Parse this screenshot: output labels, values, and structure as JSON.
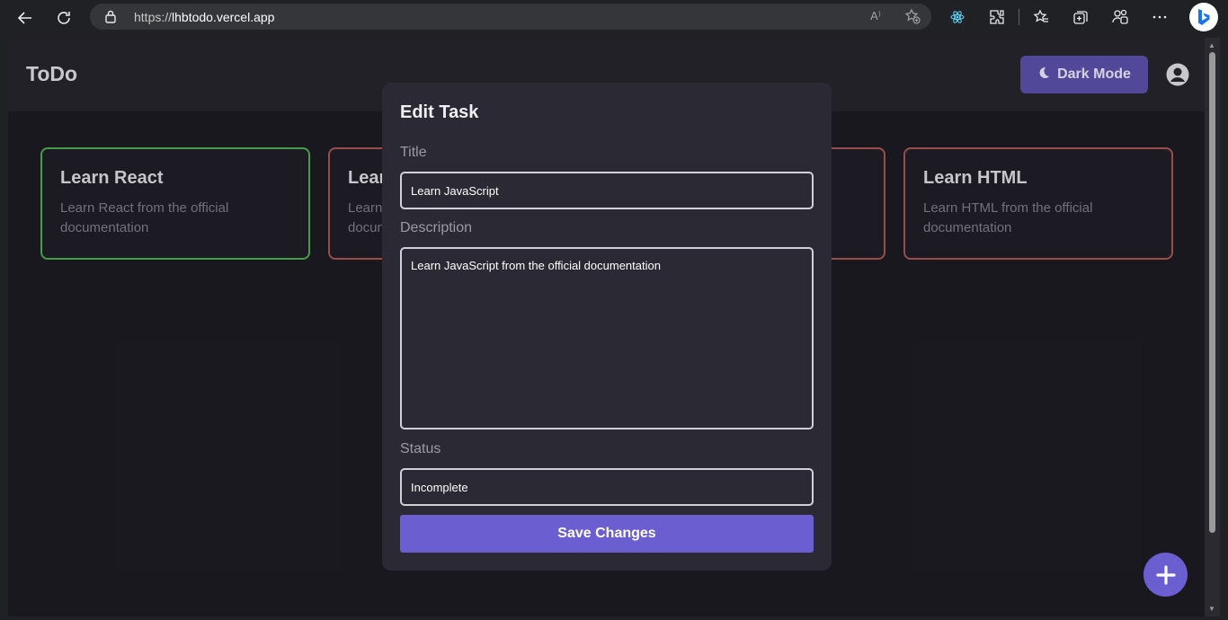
{
  "browser": {
    "url_prefix": "https://",
    "url_host": "lhbtodo.vercel.app",
    "read_aloud": "A⁾"
  },
  "app": {
    "logo": "ToDo",
    "dark_mode_label": "Dark Mode"
  },
  "cards": [
    {
      "title": "Learn React",
      "description": "Learn React from the official documentation",
      "status": "complete"
    },
    {
      "title": "Lear",
      "description": "Learn\ndocun",
      "status": "incomplete"
    },
    {
      "title": "",
      "description": "",
      "status": "incomplete"
    },
    {
      "title": "Learn HTML",
      "description": "Learn HTML from the official documentation",
      "status": "incomplete"
    }
  ],
  "modal": {
    "title": "Edit Task",
    "title_label": "Title",
    "title_value": "Learn JavaScript",
    "description_label": "Description",
    "description_value": "Learn JavaScript from the official documentation",
    "status_label": "Status",
    "status_value": "Incomplete",
    "save_label": "Save Changes"
  },
  "colors": {
    "accent": "#6b5ed0",
    "complete_border": "#4caa50",
    "incomplete_border": "#a65452"
  }
}
